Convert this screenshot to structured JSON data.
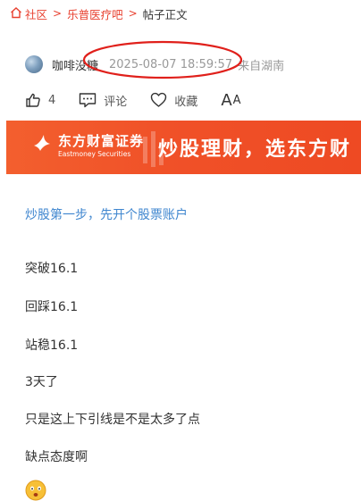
{
  "breadcrumb": {
    "items": [
      "社区",
      "乐普医疗吧"
    ],
    "current": "帖子正文"
  },
  "post": {
    "author": "咖啡没糖",
    "time": "2025-08-07 18:59:57",
    "location": "来自湖南"
  },
  "actions": {
    "like_count": "4",
    "comment_label": "评论",
    "favorite_label": "收藏",
    "font_big": "A",
    "font_small": "A"
  },
  "banner": {
    "brand": "东方财富证券",
    "brand_en": "Eastmoney Securities",
    "slogan": "炒股理财，选东方财"
  },
  "promo_link": "炒股第一步，先开个股票账户",
  "content": [
    "突破16.1",
    "回踩16.1",
    "站稳16.1",
    "3天了",
    "只是这上下引线是不是太多了点",
    "缺点态度啊"
  ],
  "colors": {
    "accent": "#e8402f",
    "banner": "#f05128",
    "link": "#3f86cf",
    "annotation": "#e0201b"
  },
  "icons": [
    "home-icon",
    "thumb-up-icon",
    "comment-icon",
    "heart-icon",
    "eastmoney-logo-icon",
    "emoji-icon"
  ]
}
